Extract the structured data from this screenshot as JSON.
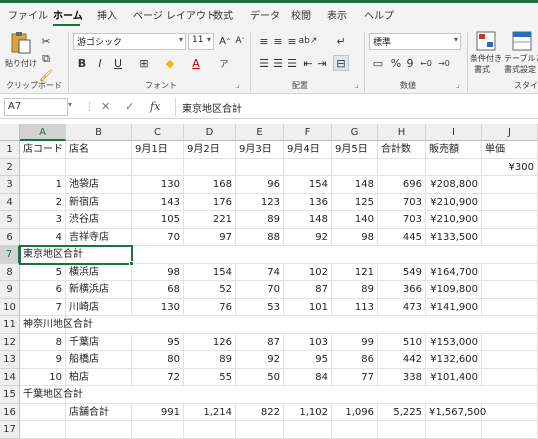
{
  "tabs": [
    "ファイル",
    "ホーム",
    "挿入",
    "ページ レイアウト",
    "数式",
    "データ",
    "校閲",
    "表示",
    "ヘルプ"
  ],
  "ribbon": {
    "paste_label": "貼り付け",
    "clipboard_label": "クリップボード",
    "font_name": "游ゴシック",
    "font_size": "11",
    "font_group_label": "フォント",
    "align_group_label": "配置",
    "number_format": "標準",
    "number_group_label": "数値",
    "cond_format_label": "条件付き",
    "cond_format_label2": "書式",
    "table_format_label": "テーブルと",
    "table_format_label2": "書式設定",
    "style_group_label": "スタイル"
  },
  "formula_bar": {
    "name_box": "A7",
    "content": "東京地区合計"
  },
  "sheet": {
    "columns": [
      "A",
      "B",
      "C",
      "D",
      "E",
      "F",
      "G",
      "H",
      "I",
      "J"
    ],
    "selected_cell": "A7",
    "rows": [
      [
        "店コード",
        "店名",
        "9月1日",
        "9月2日",
        "9月3日",
        "9月4日",
        "9月5日",
        "合計数",
        "販売額",
        "単価"
      ],
      [
        "",
        "",
        "",
        "",
        "",
        "",
        "",
        "",
        "",
        "¥300"
      ],
      [
        "1",
        "池袋店",
        "130",
        "168",
        "96",
        "154",
        "148",
        "696",
        "¥208,800",
        ""
      ],
      [
        "2",
        "新宿店",
        "143",
        "176",
        "123",
        "136",
        "125",
        "703",
        "¥210,900",
        ""
      ],
      [
        "3",
        "渋谷店",
        "105",
        "221",
        "89",
        "148",
        "140",
        "703",
        "¥210,900",
        ""
      ],
      [
        "4",
        "吉祥寺店",
        "70",
        "97",
        "88",
        "92",
        "98",
        "445",
        "¥133,500",
        ""
      ],
      [
        "東京地区合計",
        "",
        "",
        "",
        "",
        "",
        "",
        "",
        "",
        ""
      ],
      [
        "5",
        "横浜店",
        "98",
        "154",
        "74",
        "102",
        "121",
        "549",
        "¥164,700",
        ""
      ],
      [
        "6",
        "新横浜店",
        "68",
        "52",
        "70",
        "87",
        "89",
        "366",
        "¥109,800",
        ""
      ],
      [
        "7",
        "川崎店",
        "130",
        "76",
        "53",
        "101",
        "113",
        "473",
        "¥141,900",
        ""
      ],
      [
        "神奈川地区合計",
        "",
        "",
        "",
        "",
        "",
        "",
        "",
        "",
        ""
      ],
      [
        "8",
        "千葉店",
        "95",
        "126",
        "87",
        "103",
        "99",
        "510",
        "¥153,000",
        ""
      ],
      [
        "9",
        "船橋店",
        "80",
        "89",
        "92",
        "95",
        "86",
        "442",
        "¥132,600",
        ""
      ],
      [
        "10",
        "柏店",
        "72",
        "55",
        "50",
        "84",
        "77",
        "338",
        "¥101,400",
        ""
      ],
      [
        "千葉地区合計",
        "",
        "",
        "",
        "",
        "",
        "",
        "",
        "",
        ""
      ],
      [
        "",
        "店舗合計",
        "991",
        "1,214",
        "822",
        "1,102",
        "1,096",
        "5,225",
        "¥1,567,500",
        ""
      ],
      [
        "",
        "",
        "",
        "",
        "",
        "",
        "",
        "",
        "",
        ""
      ]
    ]
  },
  "colors": {
    "accent": "#1e7145",
    "header_bg": "#efefef",
    "ribbon_bg": "#f3f3f3"
  }
}
